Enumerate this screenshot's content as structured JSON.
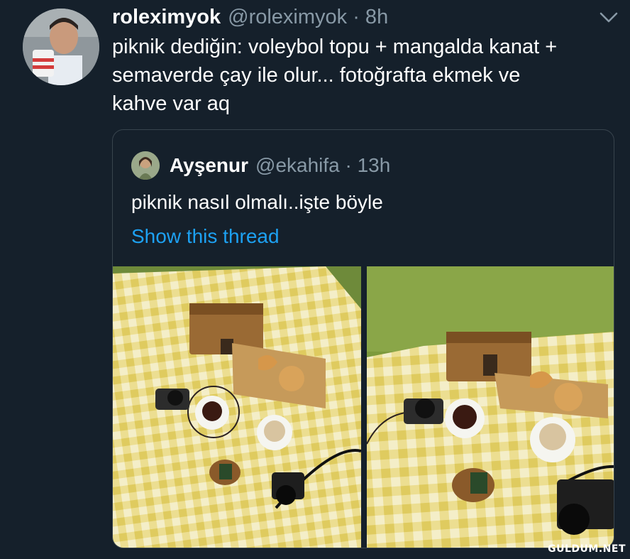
{
  "tweet": {
    "display_name": "roleximyok",
    "handle_and_time": "@roleximyok · 8h",
    "text": "piknik dediğin: voleybol topu + mangalda kanat +\nsemaverde çay ile olur... fotoğrafta ekmek ve\nkahve var aq",
    "avatar_icon": "profile-photo-man-with-cup",
    "menu_icon": "chevron-down-icon"
  },
  "quoted_tweet": {
    "display_name": "Ayşenur",
    "handle_and_time": "@ekahifa · 13h",
    "text": "piknik nasıl olmalı..işte böyle",
    "show_thread_label": "Show this thread",
    "photos": [
      {
        "description_icon": "picnic-blanket-photo-1"
      },
      {
        "description_icon": "picnic-blanket-photo-2"
      }
    ]
  },
  "watermark": "GULDUM.NET",
  "colors": {
    "background": "#15202b",
    "secondary_text": "#8899a6",
    "link": "#1da1f2",
    "border": "#38444d"
  }
}
